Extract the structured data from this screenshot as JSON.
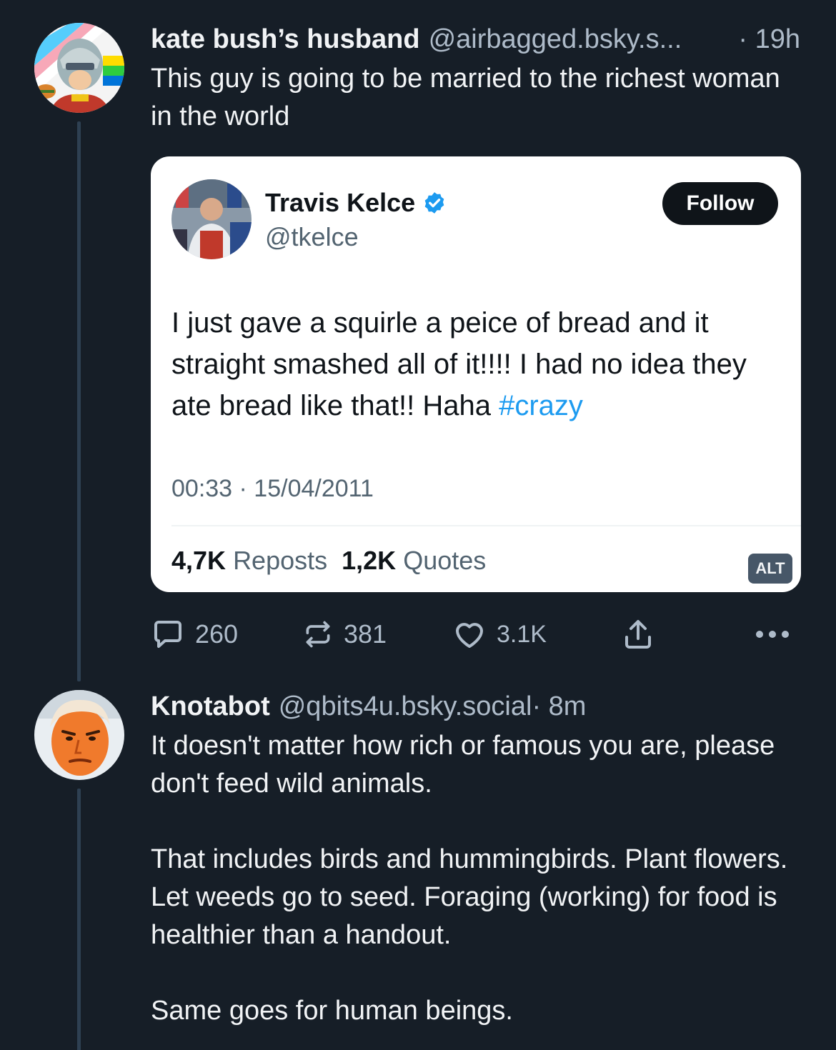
{
  "colors": {
    "background": "#161e27",
    "text_primary": "#f1f3f5",
    "text_secondary": "#aebbc9",
    "thread_line": "#2e4052",
    "hashtag": "#1d9bf0"
  },
  "posts": [
    {
      "display_name": "kate bush’s husband",
      "handle": "@airbagged.bsky.s...",
      "time": "· 19h",
      "text": [
        "This guy is going to be married to the richest woman in the world"
      ],
      "embed": {
        "name": "Travis Kelce",
        "handle": "@tkelce",
        "follow_label": "Follow",
        "text": "I just gave a squirle a peice of bread and it straight smashed all of it!!!! I had no idea they ate bread like that!! Haha ",
        "hashtag": "#crazy",
        "date": "00:33 · 15/04/2011",
        "reposts_value": "4,7K",
        "reposts_label": "Reposts",
        "quotes_value": "1,2K",
        "quotes_label": "Quotes",
        "alt_label": "ALT"
      },
      "actions": {
        "replies": "260",
        "reposts": "381",
        "likes": "3.1K"
      }
    },
    {
      "display_name": "Knotabot",
      "handle": "@qbits4u.bsky.social",
      "time": " · 8m",
      "text": [
        "It doesn't matter how rich or famous you are, please don't feed wild animals.",
        "That includes birds and hummingbirds. Plant flowers. Let weeds go to seed. Foraging (working) for food is healthier than a handout.",
        "Same goes for human beings."
      ]
    }
  ],
  "icons": [
    "reply-icon",
    "repost-icon",
    "like-icon",
    "share-icon",
    "more-icon",
    "verified-icon"
  ]
}
